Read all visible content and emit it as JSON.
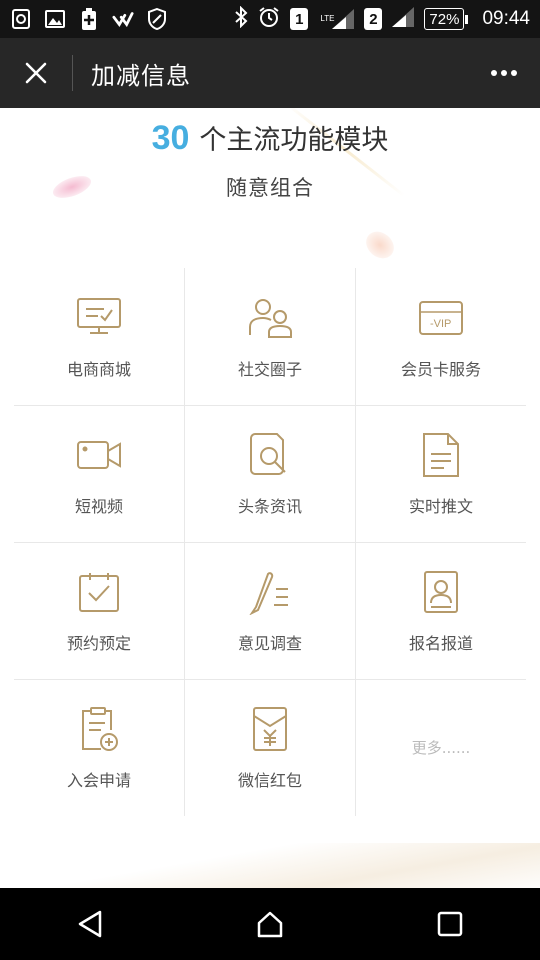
{
  "status_bar": {
    "sim1": "1",
    "sim2": "2",
    "network": "LTE",
    "battery": "72%",
    "time": "09:44"
  },
  "title_bar": {
    "title": "加减信息",
    "close_icon": "close-icon",
    "more_icon": "more-dots-icon"
  },
  "headline": {
    "number": "30",
    "text": "个主流功能模块",
    "subtitle": "随意组合"
  },
  "modules": [
    {
      "label": "电商商城",
      "icon": "monitor-check-icon"
    },
    {
      "label": "社交圈子",
      "icon": "people-icon"
    },
    {
      "label": "会员卡服务",
      "icon": "vip-card-icon"
    },
    {
      "label": "短视频",
      "icon": "video-camera-icon"
    },
    {
      "label": "头条资讯",
      "icon": "search-document-icon"
    },
    {
      "label": "实时推文",
      "icon": "document-lines-icon"
    },
    {
      "label": "预约预定",
      "icon": "calendar-check-icon"
    },
    {
      "label": "意见调查",
      "icon": "pen-lines-icon"
    },
    {
      "label": "报名报道",
      "icon": "id-card-icon"
    },
    {
      "label": "入会申请",
      "icon": "clipboard-plus-icon"
    },
    {
      "label": "微信红包",
      "icon": "red-envelope-icon"
    },
    {
      "label": "更多......",
      "icon": ""
    }
  ],
  "colors": {
    "accent": "#46aee0",
    "icon": "#b59a6a",
    "title_bar": "#272727",
    "status_bar": "#141414"
  }
}
